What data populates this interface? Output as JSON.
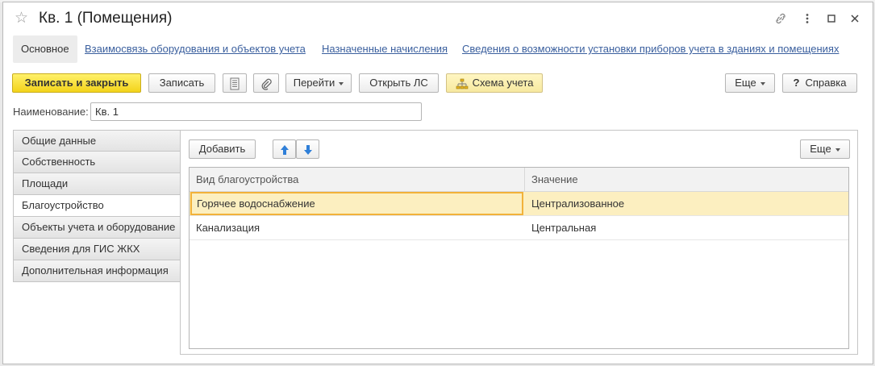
{
  "window": {
    "title": "Кв. 1 (Помещения)"
  },
  "nav": {
    "active": "Основное",
    "links": [
      "Взаимосвязь оборудования и объектов учета",
      "Назначенные начисления",
      "Сведения о возможности установки приборов учета в зданиях и помещениях"
    ]
  },
  "toolbar": {
    "save_close": "Записать и закрыть",
    "save": "Записать",
    "goto": "Перейти",
    "open_ls": "Открыть ЛС",
    "scheme": "Схема учета",
    "more": "Еще",
    "help": "Справка"
  },
  "form": {
    "name_label": "Наименование:",
    "name_value": "Кв. 1"
  },
  "tabs": [
    "Общие данные",
    "Собственность",
    "Площади",
    "Благоустройство",
    "Объекты учета и оборудование",
    "Сведения для ГИС ЖКХ",
    "Дополнительная информация"
  ],
  "active_tab_index": 3,
  "panel": {
    "add": "Добавить",
    "more": "Еще",
    "columns": [
      "Вид благоустройства",
      "Значение"
    ],
    "rows": [
      {
        "kind": "Горячее водоснабжение",
        "value": "Централизованное"
      },
      {
        "kind": "Канализация",
        "value": "Центральная"
      }
    ]
  },
  "colors": {
    "primary_button": "#f3d31a",
    "selected_row": "#fcefc0",
    "link": "#3a5f9e"
  }
}
